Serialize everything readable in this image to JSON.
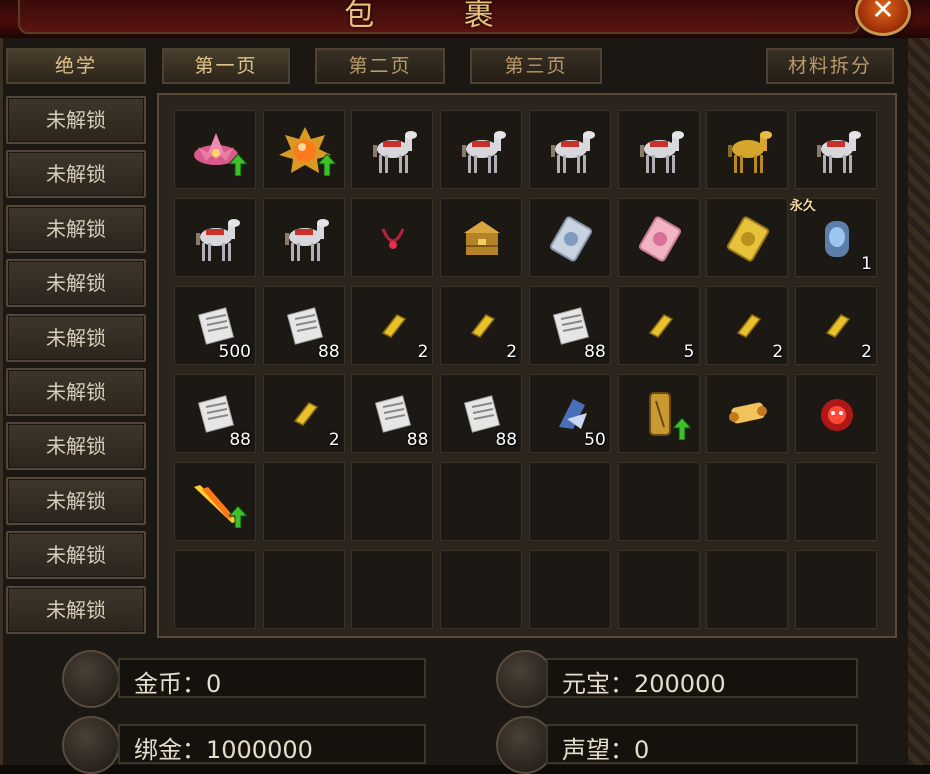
{
  "title": "包 裹",
  "close_label": "✕",
  "tabs": {
    "side_tab": "绝学",
    "page1": "第一页",
    "page2": "第二页",
    "page3": "第三页",
    "split": "材料拆分"
  },
  "skills": [
    "未解锁",
    "未解锁",
    "未解锁",
    "未解锁",
    "未解锁",
    "未解锁",
    "未解锁",
    "未解锁",
    "未解锁",
    "未解锁"
  ],
  "items": [
    {
      "icon": "lotus-icon",
      "qty": "",
      "upgrade": true
    },
    {
      "icon": "sun-orb-icon",
      "qty": "",
      "upgrade": true
    },
    {
      "icon": "white-horse-icon",
      "qty": ""
    },
    {
      "icon": "white-horse-icon",
      "qty": ""
    },
    {
      "icon": "white-horse-icon",
      "qty": ""
    },
    {
      "icon": "white-horse-icon",
      "qty": ""
    },
    {
      "icon": "golden-horse-icon",
      "qty": ""
    },
    {
      "icon": "white-horse-icon",
      "qty": ""
    },
    {
      "icon": "white-horse-icon",
      "qty": ""
    },
    {
      "icon": "white-horse-icon",
      "qty": ""
    },
    {
      "icon": "necklace-icon",
      "qty": ""
    },
    {
      "icon": "treasure-chest-icon",
      "qty": ""
    },
    {
      "icon": "silver-card-icon",
      "qty": ""
    },
    {
      "icon": "pink-card-icon",
      "qty": ""
    },
    {
      "icon": "gold-card-icon",
      "qty": ""
    },
    {
      "icon": "blue-gem-icon",
      "qty": "1",
      "tag": "永久"
    },
    {
      "icon": "scroll-icon",
      "qty": "500"
    },
    {
      "icon": "scroll-icon",
      "qty": "88"
    },
    {
      "icon": "gold-bar-icon",
      "qty": "2"
    },
    {
      "icon": "gold-bar-icon",
      "qty": "2"
    },
    {
      "icon": "scroll-icon",
      "qty": "88"
    },
    {
      "icon": "gold-bar-icon",
      "qty": "5"
    },
    {
      "icon": "gold-bar-icon",
      "qty": "2"
    },
    {
      "icon": "gold-bar-icon",
      "qty": "2"
    },
    {
      "icon": "scroll-icon",
      "qty": "88"
    },
    {
      "icon": "gold-bar-icon",
      "qty": "2"
    },
    {
      "icon": "scroll-icon",
      "qty": "88"
    },
    {
      "icon": "scroll-icon",
      "qty": "88"
    },
    {
      "icon": "blue-crystal-icon",
      "qty": "50"
    },
    {
      "icon": "gold-token-icon",
      "qty": "",
      "upgrade": true
    },
    {
      "icon": "paper-scroll-icon",
      "qty": ""
    },
    {
      "icon": "red-demon-icon",
      "qty": ""
    },
    {
      "icon": "flame-blade-icon",
      "qty": "",
      "upgrade": true
    }
  ],
  "currency": {
    "gold": "金币：0",
    "yuanbao": "元宝：200000",
    "bound_gold": "绑金：1000000",
    "prestige": "声望：0"
  },
  "colors": {
    "accent": "#e8c27a",
    "upgrade_arrow": "#3fbf2a",
    "title_bg": "#4a0d0b"
  }
}
